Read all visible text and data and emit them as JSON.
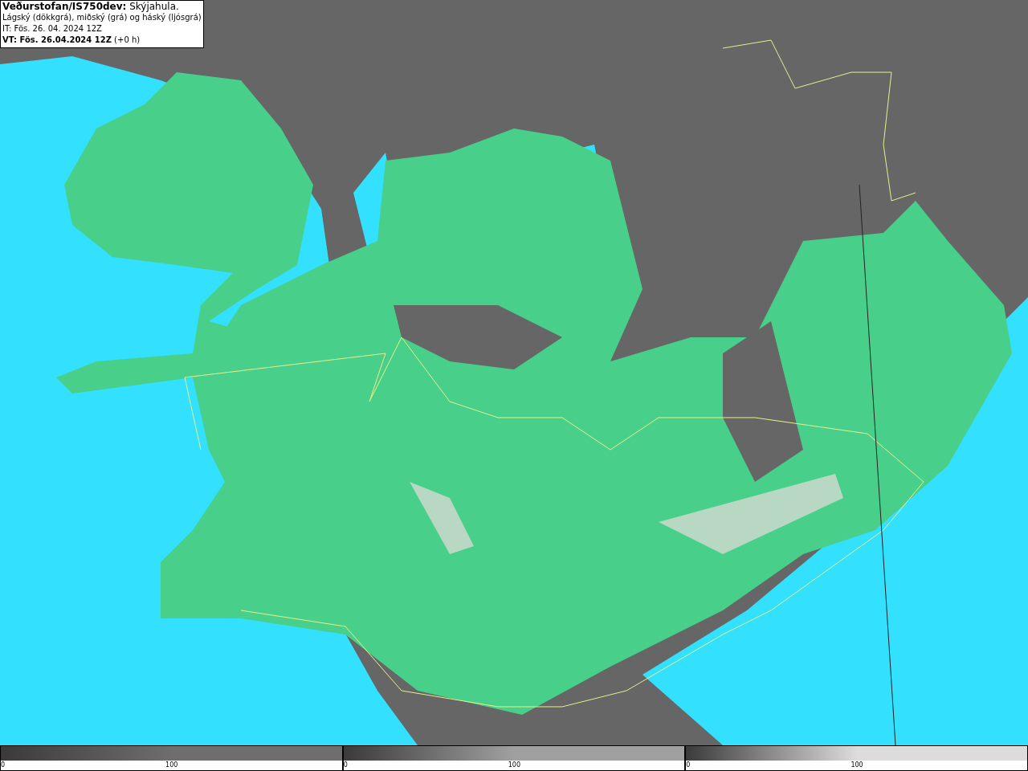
{
  "info_box": {
    "lines": [
      "**Veðurstofan/IS750dev:** Skýjahula.",
      "Lágský (dökkgrá), miðský (grá) og háský (ljósgrá)",
      "IT: Fös. 26. 04. 2024 12Z",
      "**VT: Fös. 26.04.2024 12Z** (+0 h)"
    ]
  },
  "legend": [
    {
      "color": "#6e6e6e",
      "ticks": [
        "0",
        "100"
      ]
    },
    {
      "color": "#a0a0a0",
      "ticks": [
        "0",
        "100"
      ]
    },
    {
      "color": "#dcdcdc",
      "ticks": [
        "0",
        "100"
      ]
    }
  ]
}
